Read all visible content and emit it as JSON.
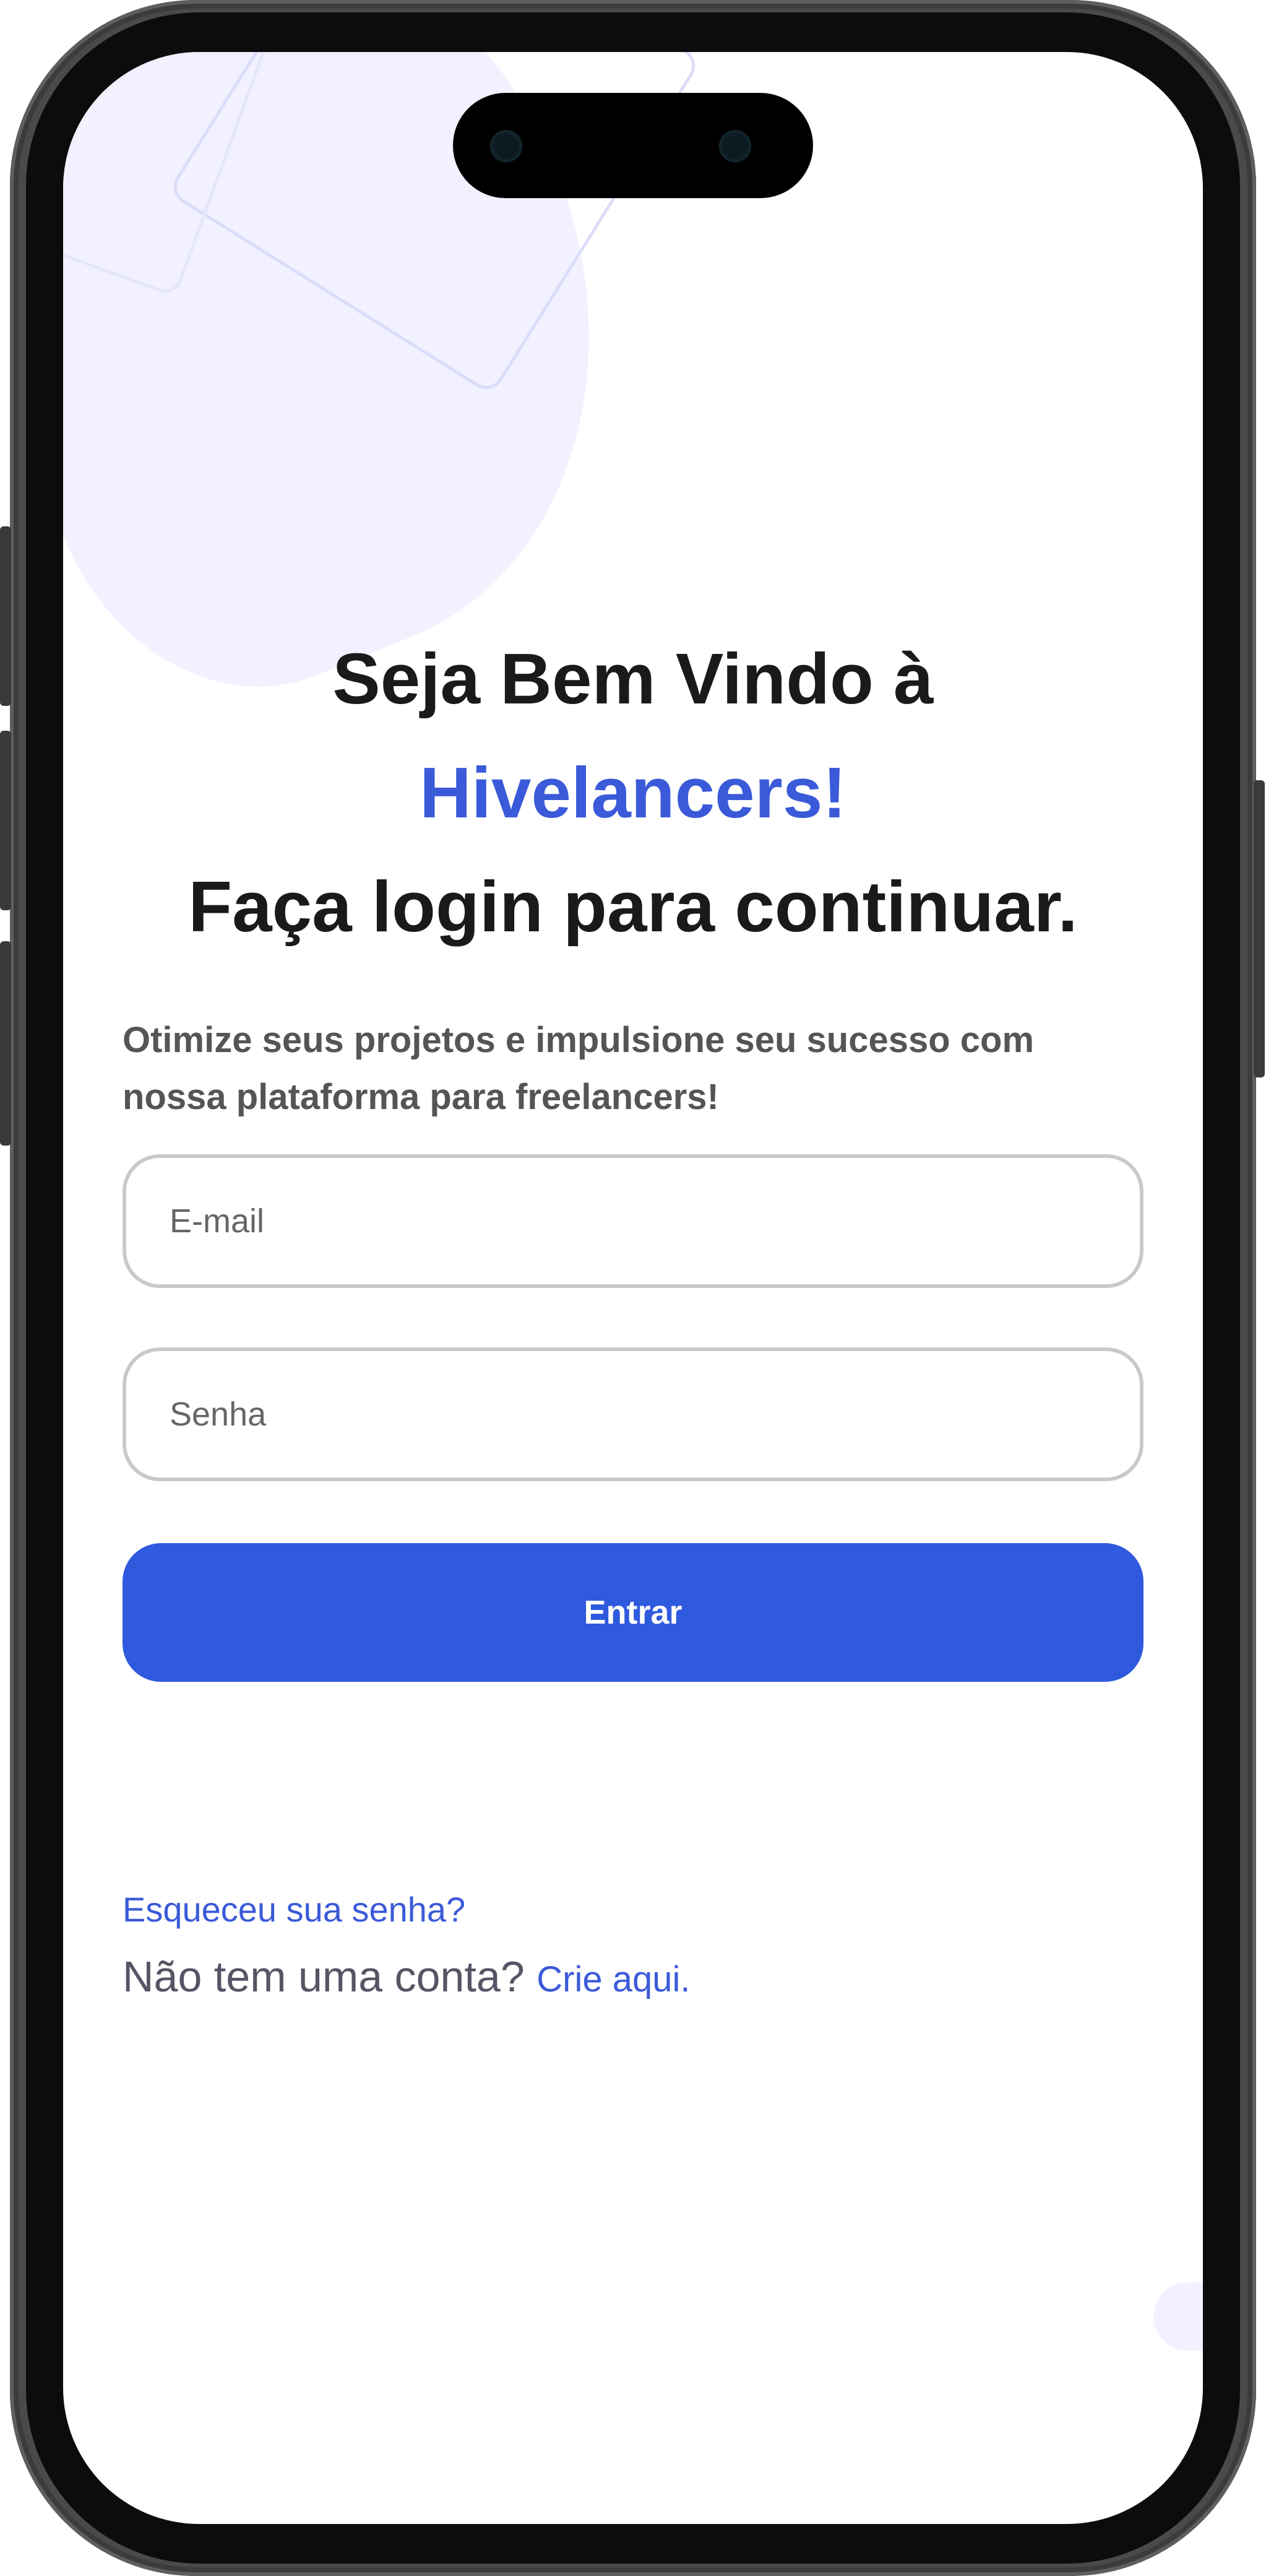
{
  "heading": {
    "line1": "Seja Bem Vindo à",
    "brand": "Hivelancers!",
    "line3": "Faça login para continuar."
  },
  "subtitle": "Otimize seus projetos e impulsione seu sucesso com nossa plataforma para freelancers!",
  "form": {
    "email_placeholder": "E-mail",
    "email_value": "",
    "password_placeholder": "Senha",
    "password_value": "",
    "submit_label": "Entrar"
  },
  "links": {
    "forgot_password": "Esqueceu sua senha?",
    "no_account_text": "Não tem uma conta?",
    "create_account": "Crie aqui."
  },
  "colors": {
    "brand_blue": "#3a5ad9",
    "button_blue": "#2f5ade",
    "heading_text": "#1a1a1a",
    "subtitle_text": "#555555",
    "decoration_lilac": "#f1f1ff"
  }
}
